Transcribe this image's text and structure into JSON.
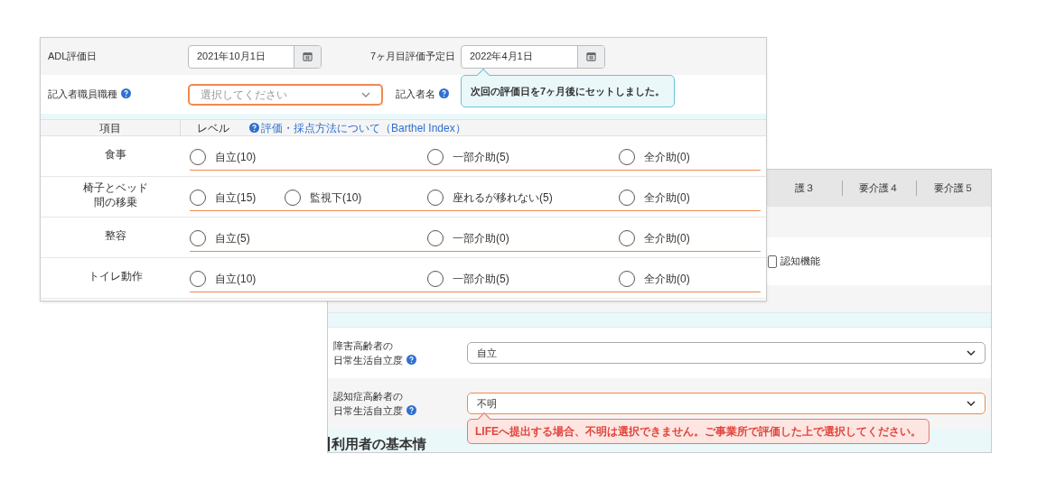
{
  "back_panel": {
    "tabs": [
      "護３",
      "要介護４",
      "要介護５"
    ],
    "checkbox": {
      "label": "認知機能",
      "checked": false
    },
    "fields": [
      {
        "label_lines": [
          "障害高齢者の",
          "日常生活自立度"
        ],
        "value": "自立",
        "error": false
      },
      {
        "label_lines": [
          "認知症高齢者の",
          "日常生活自立度"
        ],
        "value": "不明",
        "error": true,
        "error_message": "LIFEへ提出する場合、不明は選択できません。ご事業所で評価した上で選択してください。"
      }
    ],
    "section_heading": "利用者の基本情"
  },
  "front_panel": {
    "evaluation_date": {
      "label": "ADL評価日",
      "value": "2021年10月1日"
    },
    "next_date": {
      "label": "7ヶ月目評価予定日",
      "value": "2022年4月1日",
      "tooltip": "次回の評価日を7ヶ月後にセットしました。"
    },
    "recorder_type": {
      "label": "記入者職員職種",
      "placeholder": "選択してください",
      "error": true
    },
    "recorder_name": {
      "label": "記入者名"
    },
    "columns": [
      "項目",
      "レベル"
    ],
    "help_link": "評価・採点方法について（Barthel Index）",
    "rows": [
      {
        "item_lines": [
          "食事"
        ],
        "options": [
          {
            "label": "自立(10)",
            "selected": false
          },
          {
            "label": "一部介助(5)",
            "selected": false
          },
          {
            "label": "全介助(0)",
            "selected": false
          }
        ]
      },
      {
        "item_lines": [
          "椅子とベッド",
          "間の移乗"
        ],
        "options": [
          {
            "label": "自立(15)",
            "selected": false
          },
          {
            "label": "監視下(10)",
            "selected": false
          },
          {
            "label": "座れるが移れない(5)",
            "selected": false
          },
          {
            "label": "全介助(0)",
            "selected": false
          }
        ]
      },
      {
        "item_lines": [
          "整容"
        ],
        "options": [
          {
            "label": "自立(5)",
            "selected": false
          },
          {
            "label": "一部介助(0)",
            "selected": false
          },
          {
            "label": "全介助(0)",
            "selected": false
          }
        ]
      },
      {
        "item_lines": [
          "トイレ動作"
        ],
        "options": [
          {
            "label": "自立(10)",
            "selected": false
          },
          {
            "label": "一部介助(5)",
            "selected": false
          },
          {
            "label": "全介助(0)",
            "selected": false
          }
        ]
      }
    ]
  }
}
